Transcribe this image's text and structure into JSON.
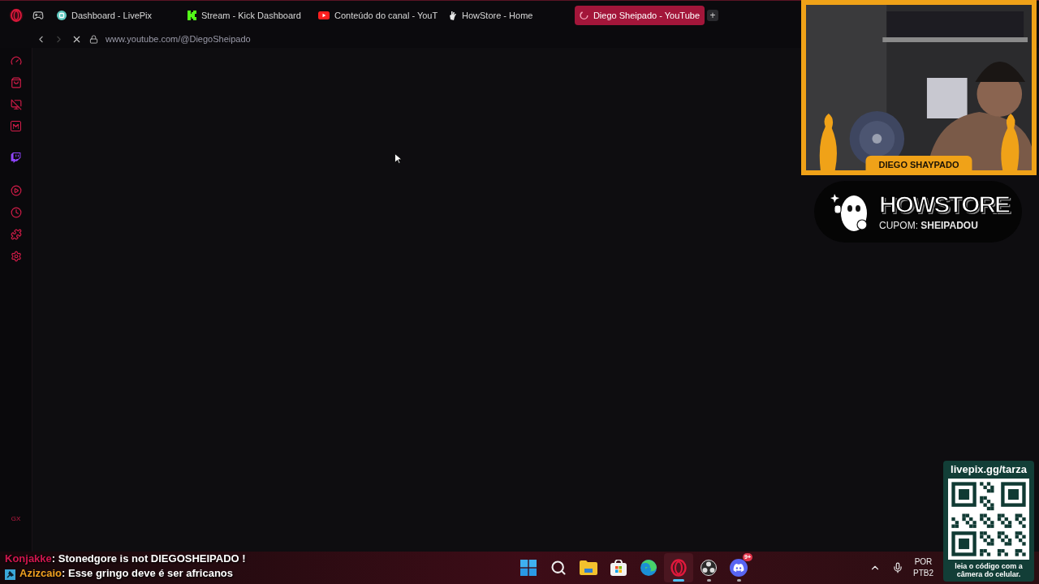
{
  "browser": {
    "tabs": [
      {
        "label": "Dashboard - LivePix",
        "kind": "livepix",
        "selected": false
      },
      {
        "label": "Stream - Kick Dashboard",
        "kind": "kick",
        "selected": false
      },
      {
        "label": "Conteúdo do canal - YouT",
        "kind": "youtube",
        "selected": false
      },
      {
        "label": "HowStore - Home",
        "kind": "howstore",
        "selected": false
      },
      {
        "label": "Diego Sheipado - YouTube",
        "kind": "loading",
        "selected": true
      }
    ],
    "new_tab_button": "+",
    "address": "www.youtube.com/@DiegoSheipado",
    "sidebar_footer": "GX"
  },
  "webcam": {
    "name_tag": "DIEGO SHAYPADO"
  },
  "sponsor": {
    "brand": "HOWSTORE",
    "coupon": "CUPOM: **SHEIPADOU**"
  },
  "chat": [
    {
      "user": "Konjakke",
      "color": "#d0164e",
      "text": ": Stonedgore is not DIEGOSHEIPADO !",
      "badge": false
    },
    {
      "user": "Azizcaio",
      "color": "#f0a020",
      "text": ": Esse gringo deve é ser africanos",
      "badge": true
    }
  ],
  "taskbar": {
    "apps": [
      {
        "kind": "windows",
        "selected": false,
        "running": false
      },
      {
        "kind": "search",
        "selected": false,
        "running": false
      },
      {
        "kind": "folder",
        "selected": false,
        "running": false
      },
      {
        "kind": "store",
        "selected": false,
        "running": false
      },
      {
        "kind": "edge",
        "selected": false,
        "running": false
      },
      {
        "kind": "opera",
        "selected": true,
        "running": true
      },
      {
        "kind": "obs",
        "selected": false,
        "running": true
      },
      {
        "kind": "discord",
        "selected": false,
        "running": true,
        "badge": "9+"
      }
    ],
    "tray": {
      "language": "POR",
      "layout": "PTB2"
    }
  },
  "donation": {
    "url": "livepix.gg/tarza",
    "caption": "leia o código com a câmera do celular."
  }
}
